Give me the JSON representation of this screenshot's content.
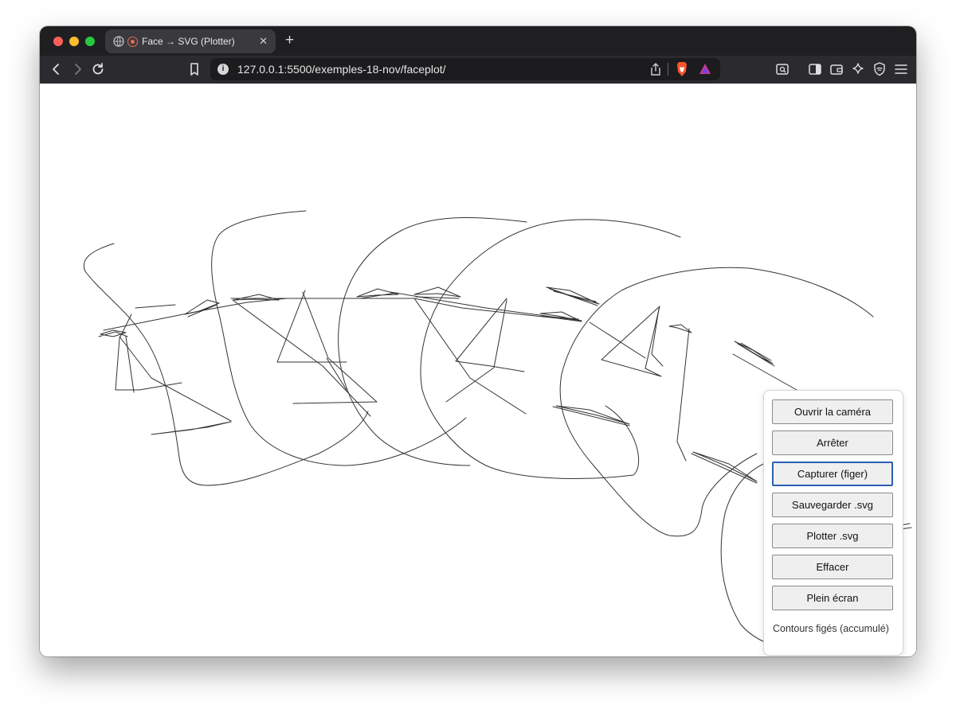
{
  "browser": {
    "tab": {
      "title": "Face → SVG (Plotter)",
      "close": "✕"
    },
    "new_tab": "+",
    "address": {
      "url": "127.0.0.1:5500/exemples-18-nov/faceplot/",
      "info": "i"
    }
  },
  "panel": {
    "buttons": [
      {
        "label": "Ouvrir la caméra"
      },
      {
        "label": "Arrêter"
      },
      {
        "label": "Capturer (figer)"
      },
      {
        "label": "Sauvegarder .svg"
      },
      {
        "label": "Plotter .svg"
      },
      {
        "label": "Effacer"
      },
      {
        "label": "Plein écran"
      }
    ],
    "status": "Contours figés (accumulé)"
  },
  "colors": {
    "stroke": "#333333",
    "focus": "#2b5fb3"
  }
}
